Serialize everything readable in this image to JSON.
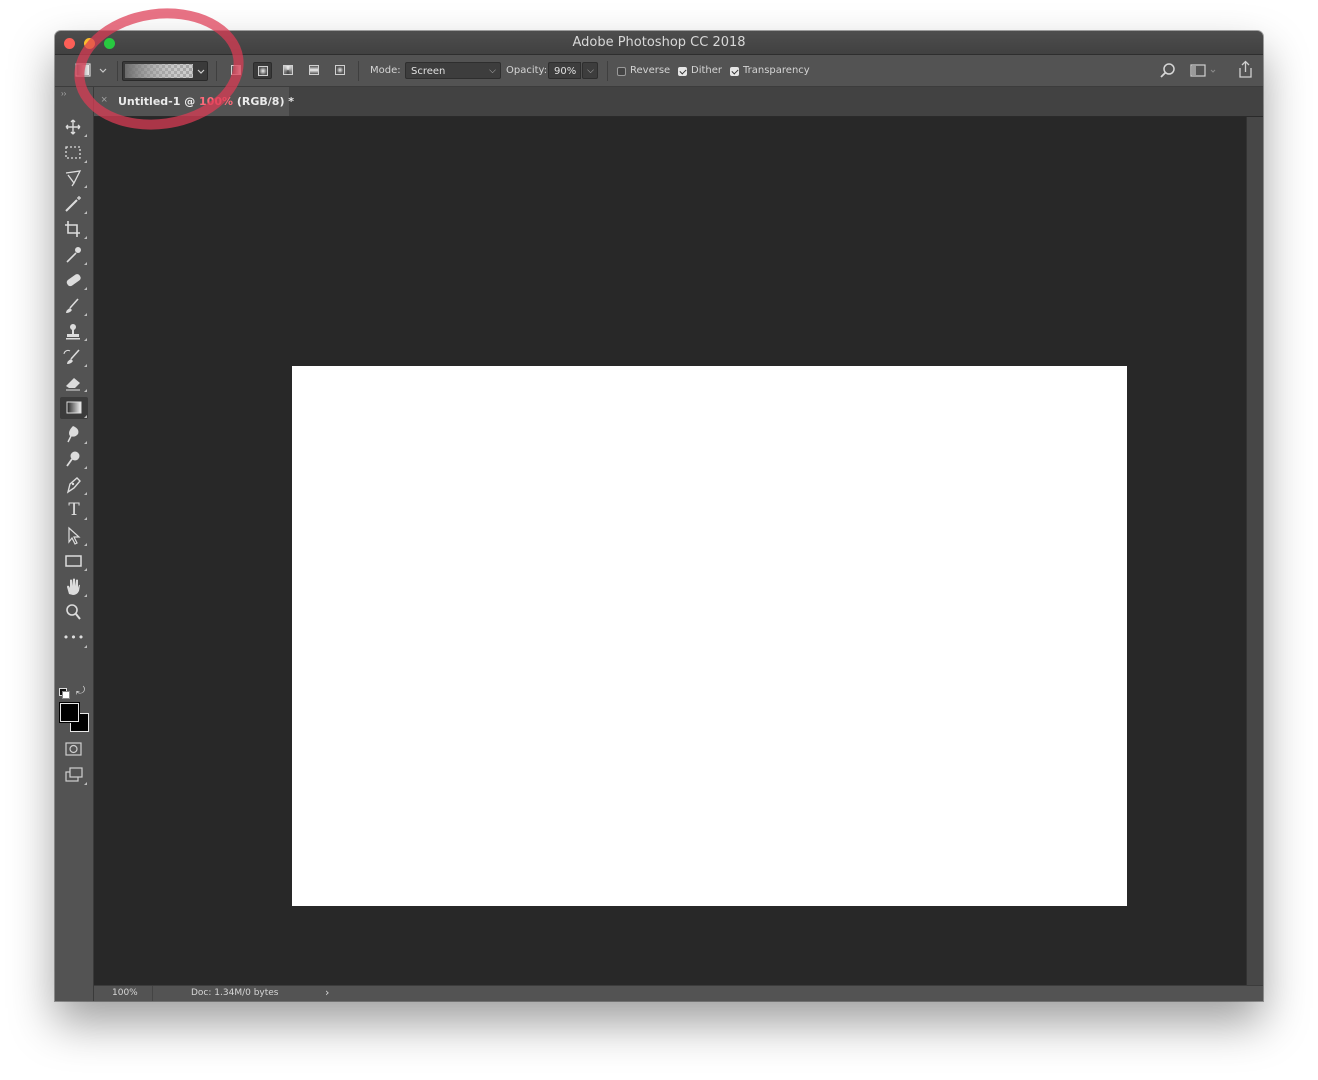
{
  "window": {
    "title": "Adobe Photoshop CC 2018"
  },
  "options_bar": {
    "mode_label": "Mode:",
    "mode_value": "Screen",
    "opacity_label": "Opacity:",
    "opacity_value": "90%",
    "reverse_label": "Reverse",
    "reverse_checked": false,
    "dither_label": "Dither",
    "dither_checked": true,
    "transparency_label": "Transparency",
    "transparency_checked": true,
    "gradient_types": [
      "linear",
      "radial",
      "angle",
      "reflected",
      "diamond"
    ],
    "selected_gradient_type": "radial"
  },
  "document_tab": {
    "close_glyph": "×",
    "name": "Untitled-1 @ ",
    "zoom": "100%",
    "mode": " (RGB/8) *"
  },
  "status_bar": {
    "zoom": "100%",
    "doc_info": "Doc: 1.34M/0 bytes",
    "arrow": "›"
  },
  "toolbar": {
    "tools": [
      "move-icon",
      "marquee-icon",
      "lasso-icon",
      "magic-wand-icon",
      "crop-icon",
      "eyedropper-icon",
      "healing-brush-icon",
      "brush-icon",
      "clone-stamp-icon",
      "history-brush-icon",
      "eraser-icon",
      "gradient-icon",
      "blur-icon",
      "dodge-icon",
      "pen-icon",
      "type-icon",
      "path-selection-icon",
      "rectangle-icon",
      "hand-icon",
      "zoom-icon",
      "more-tools-icon"
    ],
    "active_tool": "gradient-icon",
    "type_glyph": "T",
    "more_glyph": "•••"
  },
  "colors": {
    "foreground": "#000000",
    "background": "#ffffff",
    "annotation": "#de3c55"
  }
}
